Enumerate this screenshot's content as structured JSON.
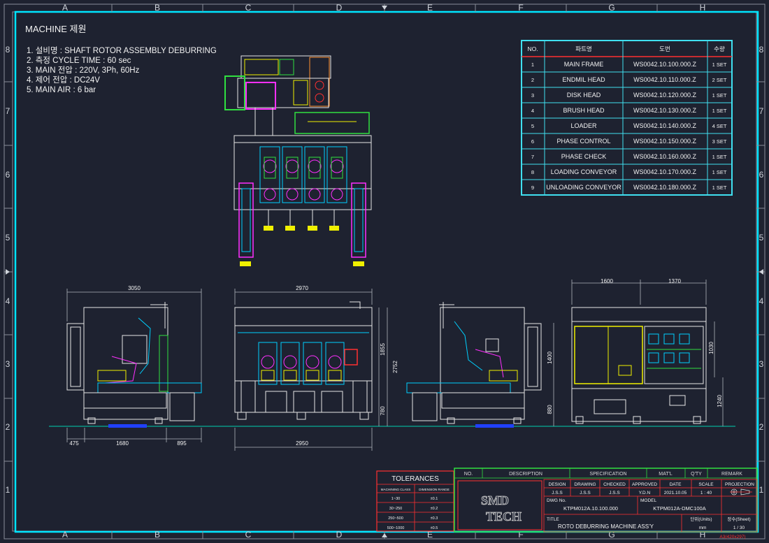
{
  "grid": {
    "cols": [
      "A",
      "B",
      "C",
      "D",
      "E",
      "F",
      "G",
      "H"
    ],
    "rows": [
      "8",
      "7",
      "6",
      "5",
      "4",
      "3",
      "2",
      "1"
    ]
  },
  "spec": {
    "title": "MACHINE 제원",
    "lines": [
      "1. 설비명 : SHAFT ROTOR ASSEMBLY DEBURRING",
      "2. 측정 CYCLE TIME : 60 sec",
      "3. MAIN 전압 : 220V, 3Ph, 60Hz",
      "4. 제어 전압 : DC24V",
      "5. MAIN AIR : 6 bar"
    ]
  },
  "parts_table": {
    "headers": [
      "NO.",
      "파트명",
      "도번",
      "수량"
    ],
    "rows": [
      [
        "1",
        "MAIN  FRAME",
        "WS0042.10.100.000.Z",
        "1 SET"
      ],
      [
        "2",
        "ENDMIL  HEAD",
        "WS0042.10.110.000.Z",
        "2 SET"
      ],
      [
        "3",
        "DISK  HEAD",
        "WS0042.10.120.000.Z",
        "1 SET"
      ],
      [
        "4",
        "BRUSH  HEAD",
        "WS0042.10.130.000.Z",
        "1 SET"
      ],
      [
        "5",
        "LOADER",
        "WS0042.10.140.000.Z",
        "4 SET"
      ],
      [
        "6",
        "PHASE  CONTROL",
        "WS0042.10.150.000.Z",
        "3 SET"
      ],
      [
        "7",
        "PHASE  CHECK",
        "WS0042.10.160.000.Z",
        "1 SET"
      ],
      [
        "8",
        "LOADING  CONVEYOR",
        "WS0042.10.170.000.Z",
        "1 SET"
      ],
      [
        "9",
        "UNLOADING  CONVEYOR",
        "WS0042.10.180.000.Z",
        "1 SET"
      ]
    ]
  },
  "dimensions": {
    "left_total": "3050",
    "left_a": "475",
    "left_b": "1680",
    "left_c": "895",
    "front_top": "2970",
    "front_bottom": "2950",
    "front_h1": "1855",
    "front_h2": "2752",
    "front_h3": "780",
    "right_h1": "1400",
    "right_h2": "880",
    "rear_a": "1600",
    "rear_b": "1370",
    "rear_h1": "1030",
    "rear_h2": "1240"
  },
  "tolerances": {
    "title": "TOLERANCES",
    "col1": "MACHINING CLASS",
    "col2": "DIMENSION RANGE",
    "rows": [
      [
        "1~30",
        "±0.1"
      ],
      [
        "30~250",
        "±0.2"
      ],
      [
        "250~500",
        "±0.3"
      ],
      [
        "500~1000",
        "±0.5"
      ]
    ]
  },
  "titleblock": {
    "header": [
      "NO.",
      "DESCRIPTION",
      "SPECIFICATION",
      "MAT'L",
      "Q'TY",
      "REMARK"
    ],
    "logo_line1": "SMD",
    "logo_line2": "TECH",
    "labels": [
      "DESIGN",
      "DRAWING",
      "CHECKED",
      "APPROVED",
      "DATE",
      "SCALE",
      "PROJECTION"
    ],
    "values": [
      "J.S.S",
      "J.S.S",
      "J.S.S",
      "Y.D.N",
      "2021.10.05",
      "1  :  40"
    ],
    "dwg_label": "DWG No.",
    "dwg_no": "KTPM012A.10.100.000",
    "model_label": "MODEL",
    "model": "KTPM012A-DMC100A",
    "title_label": "TITLE",
    "title": "ROTO DEBURRING MACHINE ASS'Y",
    "units_label": "단위(Units)",
    "units": "mm",
    "sheet_label": "장수(Sheet)",
    "sheet": "1  /  30",
    "paper": "A3(420x297)"
  },
  "colors": {
    "background": "#1e2230",
    "border": "#00e5ff",
    "frame": "#e6e6e6",
    "table": "#40e0f0",
    "red": "#ff3030",
    "green": "#30e040",
    "yellow": "#f0f000",
    "magenta": "#ff30ff"
  }
}
